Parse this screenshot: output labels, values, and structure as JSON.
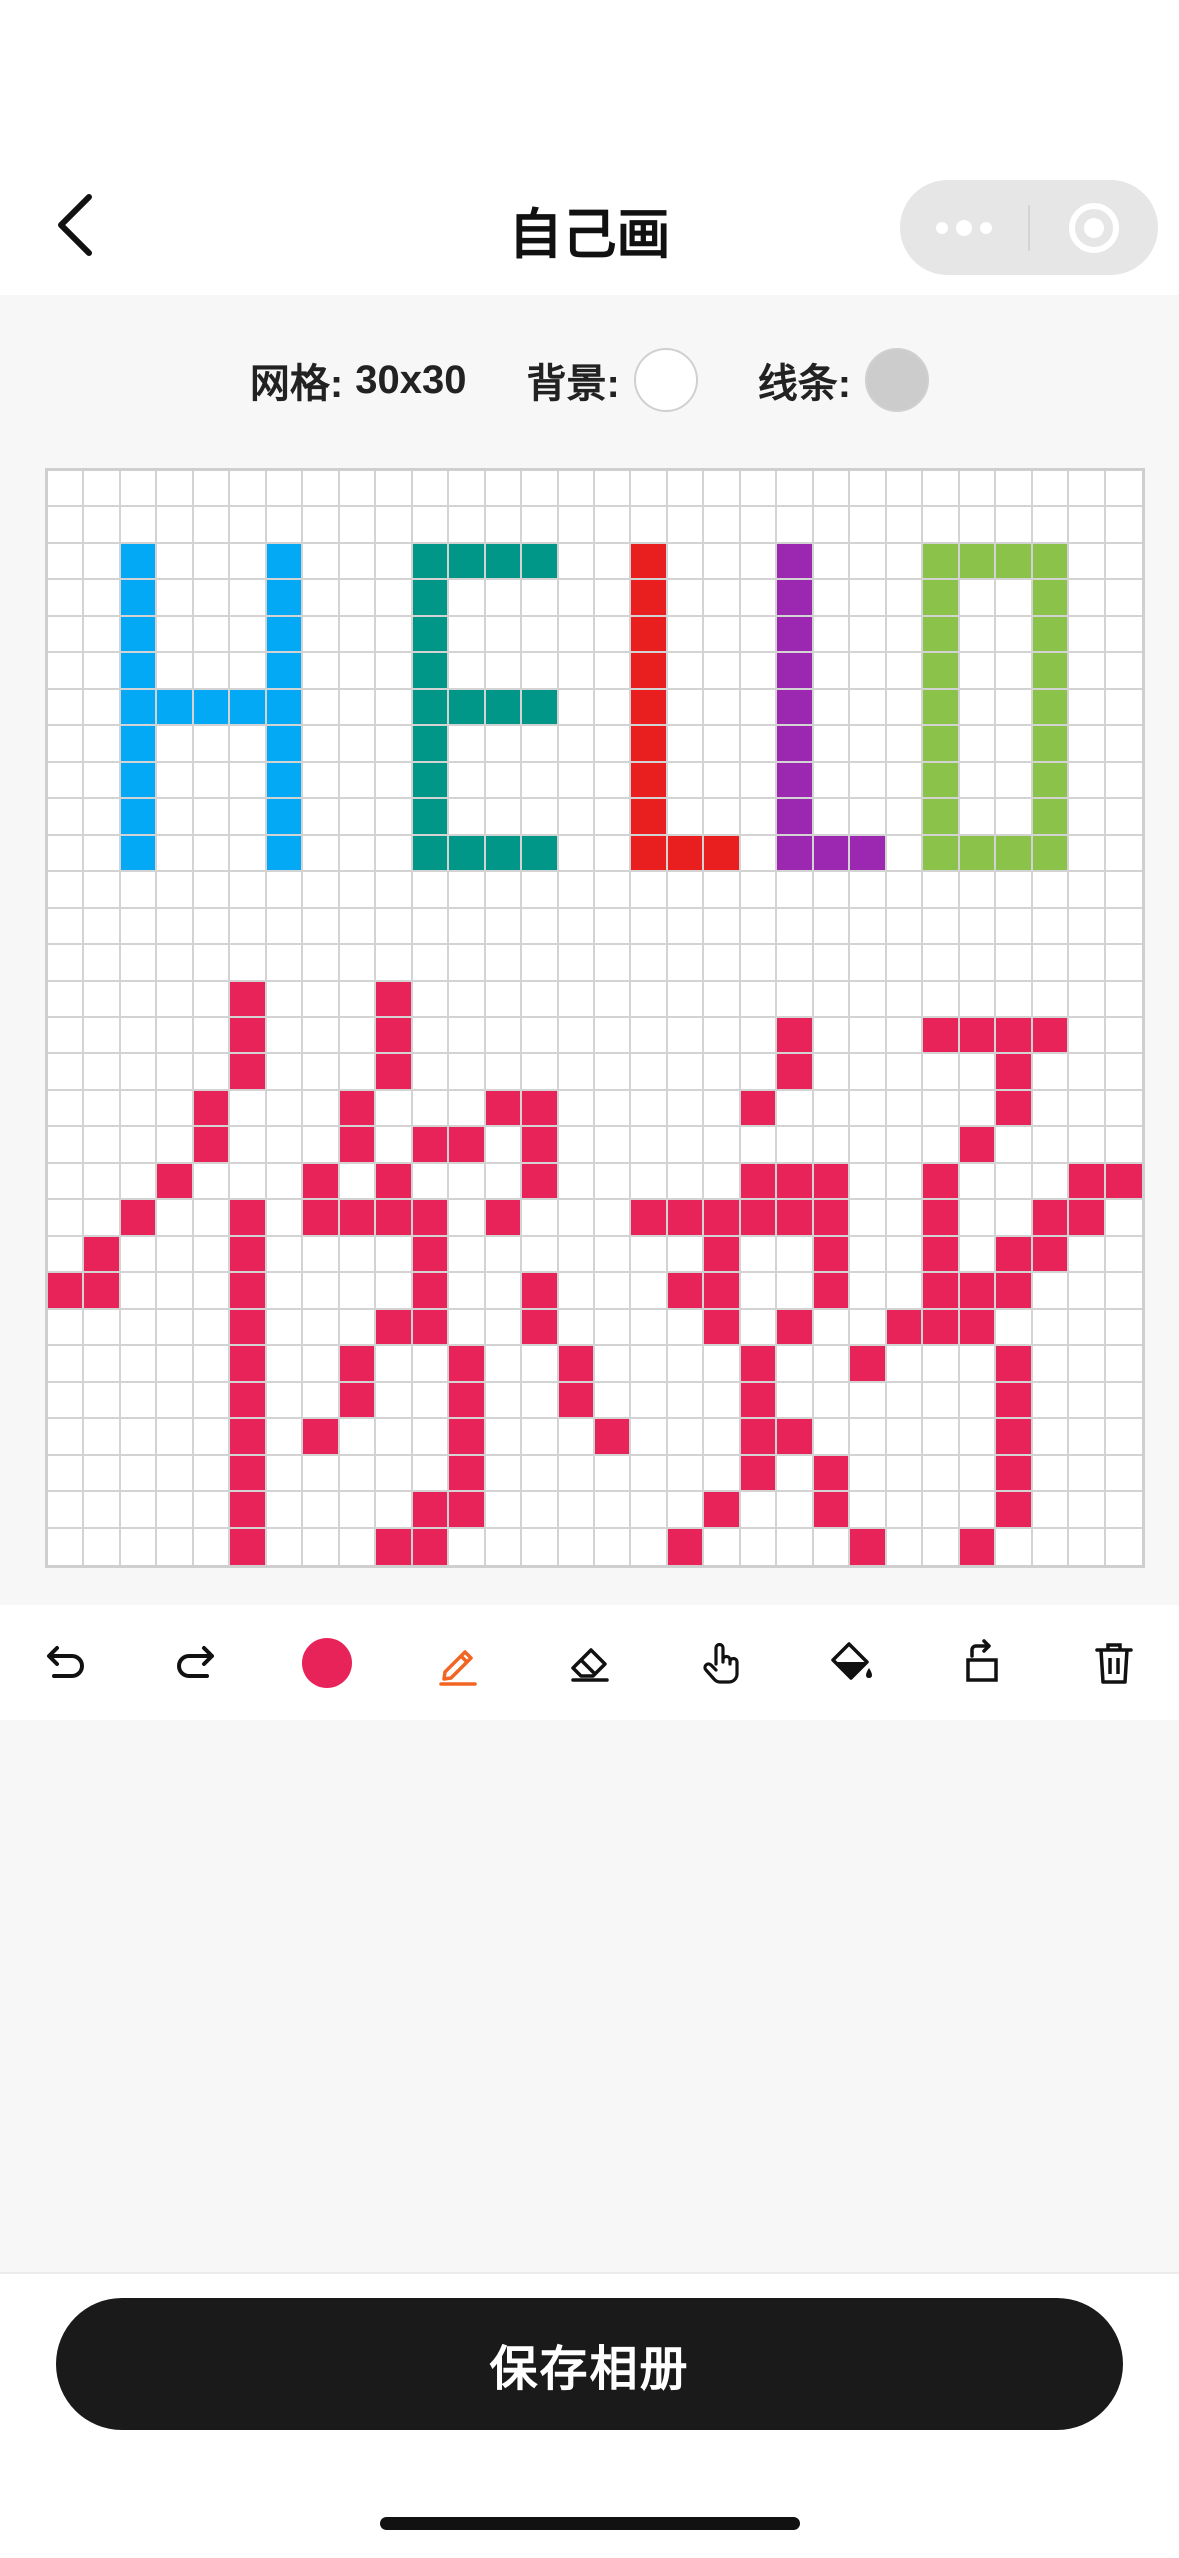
{
  "nav": {
    "title": "自己画"
  },
  "info": {
    "grid_label": "网格:",
    "grid_size": "30x30",
    "bg_label": "背景:",
    "line_label": "线条:"
  },
  "colors": {
    "background_swatch": "#ffffff",
    "line_swatch": "#cccccc",
    "current_color": "#e8235a",
    "grid_line": "#d3d3d3"
  },
  "toolbar": {
    "tools": [
      "undo-icon",
      "redo-icon",
      "color-picker",
      "pencil-icon",
      "eraser-icon",
      "hand-icon",
      "fill-bucket-icon",
      "rotate-icon",
      "trash-icon"
    ],
    "active_tool": "pencil-icon"
  },
  "save_button": {
    "label": "保存相册"
  },
  "canvas": {
    "rows": 30,
    "cols": 30,
    "pixels": [
      {
        "color": "#03a9f4",
        "cells": [
          [
            2,
            2
          ],
          [
            3,
            2
          ],
          [
            4,
            2
          ],
          [
            5,
            2
          ],
          [
            6,
            2
          ],
          [
            7,
            2
          ],
          [
            8,
            2
          ],
          [
            9,
            2
          ],
          [
            10,
            2
          ],
          [
            2,
            6
          ],
          [
            3,
            6
          ],
          [
            4,
            6
          ],
          [
            5,
            6
          ],
          [
            6,
            6
          ],
          [
            7,
            6
          ],
          [
            8,
            6
          ],
          [
            9,
            6
          ],
          [
            10,
            6
          ],
          [
            6,
            3
          ],
          [
            6,
            4
          ],
          [
            6,
            5
          ]
        ]
      },
      {
        "color": "#009688",
        "cells": [
          [
            2,
            10
          ],
          [
            3,
            10
          ],
          [
            4,
            10
          ],
          [
            5,
            10
          ],
          [
            6,
            10
          ],
          [
            7,
            10
          ],
          [
            8,
            10
          ],
          [
            9,
            10
          ],
          [
            10,
            10
          ],
          [
            2,
            11
          ],
          [
            2,
            12
          ],
          [
            2,
            13
          ],
          [
            6,
            11
          ],
          [
            6,
            12
          ],
          [
            6,
            13
          ],
          [
            10,
            11
          ],
          [
            10,
            12
          ],
          [
            10,
            13
          ]
        ]
      },
      {
        "color": "#e91e1e",
        "cells": [
          [
            2,
            16
          ],
          [
            3,
            16
          ],
          [
            4,
            16
          ],
          [
            5,
            16
          ],
          [
            6,
            16
          ],
          [
            7,
            16
          ],
          [
            8,
            16
          ],
          [
            9,
            16
          ],
          [
            10,
            16
          ],
          [
            10,
            17
          ],
          [
            10,
            18
          ]
        ]
      },
      {
        "color": "#9c27b0",
        "cells": [
          [
            2,
            20
          ],
          [
            3,
            20
          ],
          [
            4,
            20
          ],
          [
            5,
            20
          ],
          [
            6,
            20
          ],
          [
            7,
            20
          ],
          [
            8,
            20
          ],
          [
            9,
            20
          ],
          [
            10,
            20
          ],
          [
            10,
            21
          ],
          [
            10,
            22
          ]
        ]
      },
      {
        "color": "#8bc34a",
        "cells": [
          [
            2,
            24
          ],
          [
            3,
            24
          ],
          [
            4,
            24
          ],
          [
            5,
            24
          ],
          [
            6,
            24
          ],
          [
            7,
            24
          ],
          [
            8,
            24
          ],
          [
            9,
            24
          ],
          [
            10,
            24
          ],
          [
            2,
            25
          ],
          [
            2,
            26
          ],
          [
            2,
            27
          ],
          [
            10,
            25
          ],
          [
            10,
            26
          ],
          [
            10,
            27
          ],
          [
            3,
            27
          ],
          [
            4,
            27
          ],
          [
            5,
            27
          ],
          [
            6,
            27
          ],
          [
            7,
            27
          ],
          [
            8,
            27
          ],
          [
            9,
            27
          ]
        ]
      },
      {
        "color": "#e8235a",
        "cells": [
          [
            14,
            5
          ],
          [
            15,
            5
          ],
          [
            16,
            5
          ],
          [
            17,
            4
          ],
          [
            18,
            4
          ],
          [
            19,
            3
          ],
          [
            20,
            2
          ],
          [
            21,
            1
          ],
          [
            22,
            0
          ],
          [
            22,
            1
          ],
          [
            20,
            5
          ],
          [
            21,
            5
          ],
          [
            22,
            5
          ],
          [
            23,
            5
          ],
          [
            24,
            5
          ],
          [
            25,
            5
          ],
          [
            26,
            5
          ],
          [
            27,
            5
          ],
          [
            28,
            5
          ],
          [
            29,
            5
          ],
          [
            14,
            9
          ],
          [
            15,
            9
          ],
          [
            16,
            9
          ],
          [
            17,
            8
          ],
          [
            18,
            8
          ],
          [
            19,
            7
          ],
          [
            20,
            7
          ],
          [
            20,
            8
          ],
          [
            20,
            9
          ],
          [
            18,
            10
          ],
          [
            18,
            11
          ],
          [
            17,
            12
          ],
          [
            17,
            13
          ],
          [
            18,
            13
          ],
          [
            19,
            13
          ],
          [
            19,
            9
          ],
          [
            20,
            10
          ],
          [
            21,
            10
          ],
          [
            22,
            10
          ],
          [
            23,
            10
          ],
          [
            23,
            9
          ],
          [
            20,
            12
          ],
          [
            22,
            13
          ],
          [
            23,
            13
          ],
          [
            24,
            14
          ],
          [
            25,
            14
          ],
          [
            26,
            15
          ],
          [
            24,
            11
          ],
          [
            25,
            11
          ],
          [
            26,
            11
          ],
          [
            27,
            11
          ],
          [
            28,
            11
          ],
          [
            28,
            10
          ],
          [
            29,
            10
          ],
          [
            29,
            9
          ],
          [
            24,
            8
          ],
          [
            25,
            8
          ],
          [
            26,
            7
          ],
          [
            15,
            20
          ],
          [
            16,
            20
          ],
          [
            17,
            19
          ],
          [
            19,
            19
          ],
          [
            19,
            20
          ],
          [
            19,
            21
          ],
          [
            20,
            19
          ],
          [
            20,
            20
          ],
          [
            20,
            21
          ],
          [
            20,
            16
          ],
          [
            20,
            17
          ],
          [
            20,
            18
          ],
          [
            21,
            18
          ],
          [
            22,
            18
          ],
          [
            22,
            17
          ],
          [
            23,
            18
          ],
          [
            21,
            21
          ],
          [
            22,
            21
          ],
          [
            23,
            20
          ],
          [
            24,
            19
          ],
          [
            25,
            19
          ],
          [
            26,
            19
          ],
          [
            26,
            20
          ],
          [
            27,
            19
          ],
          [
            28,
            18
          ],
          [
            29,
            17
          ],
          [
            27,
            21
          ],
          [
            28,
            21
          ],
          [
            29,
            22
          ],
          [
            24,
            22
          ],
          [
            23,
            23
          ],
          [
            23,
            24
          ],
          [
            15,
            24
          ],
          [
            15,
            25
          ],
          [
            15,
            26
          ],
          [
            15,
            27
          ],
          [
            16,
            26
          ],
          [
            17,
            26
          ],
          [
            18,
            25
          ],
          [
            19,
            24
          ],
          [
            20,
            24
          ],
          [
            21,
            24
          ],
          [
            22,
            24
          ],
          [
            22,
            25
          ],
          [
            23,
            25
          ],
          [
            20,
            27
          ],
          [
            20,
            28
          ],
          [
            19,
            28
          ],
          [
            19,
            29
          ],
          [
            21,
            26
          ],
          [
            22,
            26
          ],
          [
            21,
            27
          ],
          [
            24,
            26
          ],
          [
            25,
            26
          ],
          [
            26,
            26
          ],
          [
            27,
            26
          ],
          [
            28,
            26
          ],
          [
            29,
            25
          ]
        ]
      }
    ]
  }
}
